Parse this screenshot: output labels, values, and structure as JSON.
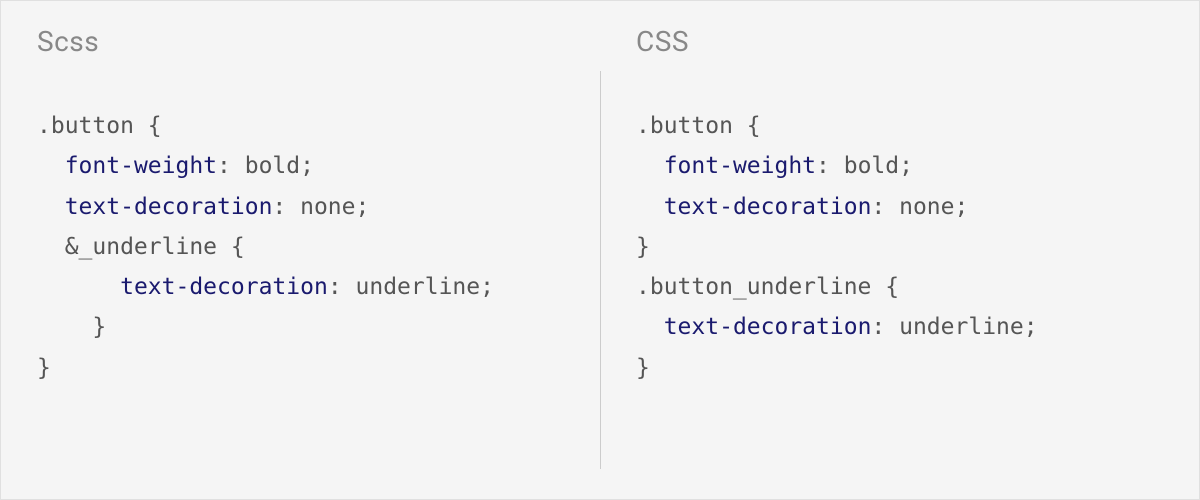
{
  "left": {
    "title": "Scss",
    "code": [
      {
        "tokens": [
          {
            "t": ".button ",
            "c": "tok-selector"
          },
          {
            "t": "{",
            "c": "tok-punc"
          }
        ]
      },
      {
        "tokens": [
          {
            "t": "  ",
            "c": ""
          },
          {
            "t": "font-weight",
            "c": "tok-prop"
          },
          {
            "t": ": bold;",
            "c": "tok-value"
          }
        ]
      },
      {
        "tokens": [
          {
            "t": "  ",
            "c": ""
          },
          {
            "t": "text-decoration",
            "c": "tok-prop"
          },
          {
            "t": ": none;",
            "c": "tok-value"
          }
        ]
      },
      {
        "tokens": [
          {
            "t": "  &_underline ",
            "c": "tok-amp"
          },
          {
            "t": "{",
            "c": "tok-punc"
          }
        ]
      },
      {
        "tokens": [
          {
            "t": "      ",
            "c": ""
          },
          {
            "t": "text-decoration",
            "c": "tok-prop"
          },
          {
            "t": ": underline;",
            "c": "tok-value"
          }
        ]
      },
      {
        "tokens": [
          {
            "t": "    }",
            "c": "tok-punc"
          }
        ]
      },
      {
        "tokens": [
          {
            "t": "}",
            "c": "tok-punc"
          }
        ]
      }
    ]
  },
  "right": {
    "title": "CSS",
    "code": [
      {
        "tokens": [
          {
            "t": ".button ",
            "c": "tok-selector"
          },
          {
            "t": "{",
            "c": "tok-punc"
          }
        ]
      },
      {
        "tokens": [
          {
            "t": "  ",
            "c": ""
          },
          {
            "t": "font-weight",
            "c": "tok-prop"
          },
          {
            "t": ": bold;",
            "c": "tok-value"
          }
        ]
      },
      {
        "tokens": [
          {
            "t": "  ",
            "c": ""
          },
          {
            "t": "text-decoration",
            "c": "tok-prop"
          },
          {
            "t": ": none;",
            "c": "tok-value"
          }
        ]
      },
      {
        "tokens": [
          {
            "t": "}",
            "c": "tok-punc"
          }
        ]
      },
      {
        "tokens": [
          {
            "t": ".button_underline ",
            "c": "tok-selector"
          },
          {
            "t": "{",
            "c": "tok-punc"
          }
        ]
      },
      {
        "tokens": [
          {
            "t": "  ",
            "c": ""
          },
          {
            "t": "text-decoration",
            "c": "tok-prop"
          },
          {
            "t": ": underline;",
            "c": "tok-value"
          }
        ]
      },
      {
        "tokens": [
          {
            "t": "}",
            "c": "tok-punc"
          }
        ]
      }
    ]
  }
}
